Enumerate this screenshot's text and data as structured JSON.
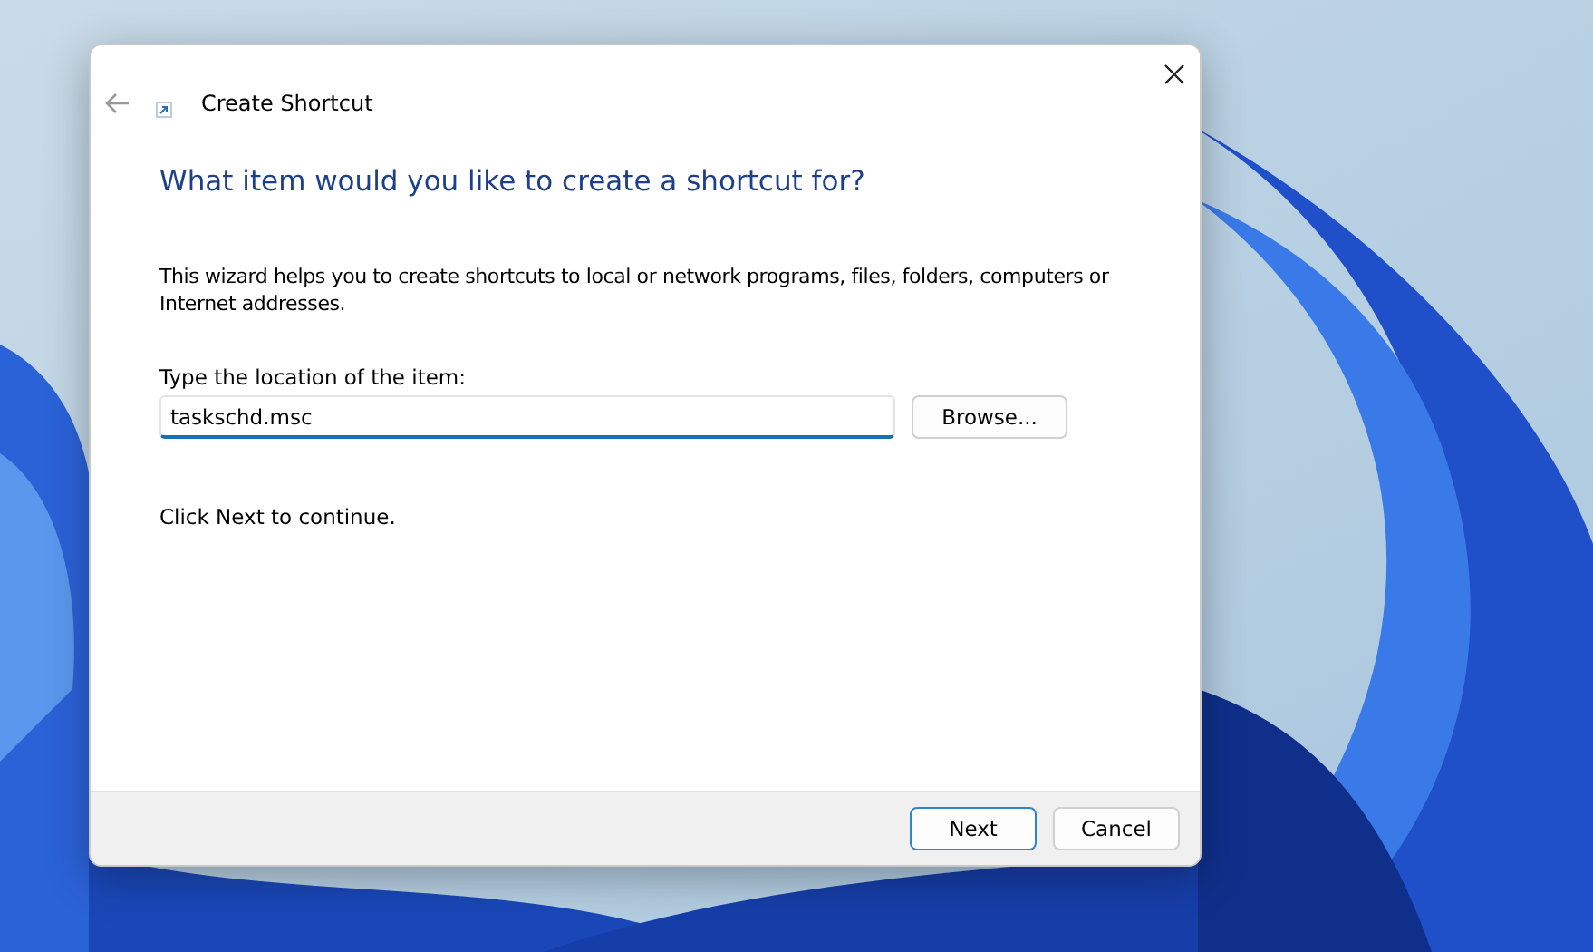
{
  "window": {
    "title": "Create Shortcut"
  },
  "heading": "What item would you like to create a shortcut for?",
  "description": "This wizard helps you to create shortcuts to local or network programs, files, folders, computers or Internet addresses.",
  "location": {
    "label": "Type the location of the item:",
    "value": "taskschd.msc",
    "focused": true
  },
  "browse_button": "Browse...",
  "hint": "Click Next to continue.",
  "buttons": [
    {
      "label": "Next",
      "default": true
    },
    {
      "label": "Cancel",
      "default": false
    }
  ]
}
